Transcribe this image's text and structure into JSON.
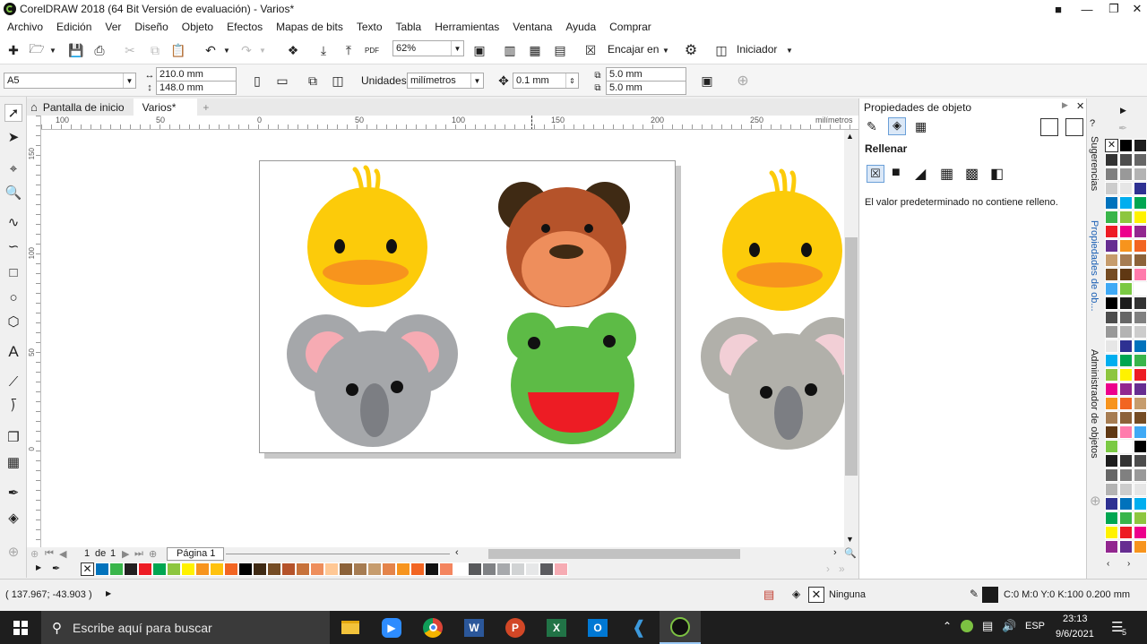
{
  "window": {
    "title": "CorelDRAW 2018 (64 Bit Versión de evaluación) - Varios*"
  },
  "menu": [
    "Archivo",
    "Edición",
    "Ver",
    "Diseño",
    "Objeto",
    "Efectos",
    "Mapas de bits",
    "Texto",
    "Tabla",
    "Herramientas",
    "Ventana",
    "Ayuda",
    "Comprar"
  ],
  "toolbar": {
    "zoom": "62%",
    "fit_label": "Encajar en",
    "launcher_label": "Iniciador"
  },
  "propbar": {
    "page_size": "A5",
    "width": "210.0 mm",
    "height": "148.0 mm",
    "units_label": "Unidades:",
    "units": "milímetros",
    "nudge": "0.1 mm",
    "dup_x": "5.0 mm",
    "dup_y": "5.0 mm"
  },
  "tabs": {
    "home": "Pantalla de inicio",
    "doc": "Varios*"
  },
  "ruler": {
    "h_ticks": [
      "100",
      "50",
      "0",
      "50",
      "100",
      "150",
      "200",
      "250"
    ],
    "unit": "milímetros",
    "v_ticks": [
      "150",
      "100",
      "50",
      "0"
    ]
  },
  "pagenav": {
    "current": "1",
    "of": "de",
    "total": "1",
    "page_tab": "Página 1"
  },
  "panel": {
    "title": "Propiedades de objeto",
    "section": "Rellenar",
    "message": "El valor predeterminado no contiene relleno."
  },
  "sidetabs": [
    "Sugerencias",
    "Propiedades de ob...",
    "Administrador de objetos"
  ],
  "status": {
    "coords": "( 137.967; -43.903 )",
    "fill_text": "Ninguna",
    "outline_text": "C:0 M:0 Y:0 K:100  0.200 mm"
  },
  "taskbar": {
    "search_placeholder": "Escribe aquí para buscar",
    "lang": "ESP",
    "time": "23:13",
    "date": "9/6/2021",
    "notif_count": "5"
  },
  "colors": {
    "duck": "#fccb0a",
    "beak": "#f7941d",
    "bear": "#b5532a",
    "bear_ear": "#3f2a14",
    "bear_muzzle": "#ee8e5c",
    "koala": "#a5a7aa",
    "koala_ear": "#f6abb3",
    "koala_nose": "#7c7e83",
    "frog": "#5dbb46",
    "mouth": "#ed1c24",
    "canvas": "#ffffff"
  },
  "doc_palette": [
    "#0072bc",
    "#39b54a",
    "#231f20",
    "#ed1c24",
    "#00a651",
    "#8dc63f",
    "#fff200",
    "#f7941d",
    "#ffc20e",
    "#f26522",
    "#000000",
    "#3f2a14",
    "#754c24",
    "#b5532a",
    "#c7723a",
    "#ee8e5c",
    "#ffc895",
    "#8c6239",
    "#a67c52",
    "#c69c6d",
    "#e4844a",
    "#f7941d",
    "#f26522",
    "#111111",
    "#f4855e",
    "#ffffff",
    "#58595b",
    "#808285",
    "#a7a9ac",
    "#d1d3d4",
    "#e6e7e8",
    "#5b5b5f",
    "#f6abb3"
  ],
  "color_palette": [
    "#ffffff",
    "#000000",
    "#1d1d1d",
    "#333333",
    "#4d4d4d",
    "#666666",
    "#808080",
    "#999999",
    "#b3b3b3",
    "#cccccc",
    "#e6e6e6",
    "#2e3192",
    "#0072bc",
    "#00aeef",
    "#00a651",
    "#39b54a",
    "#8dc63f",
    "#fff200",
    "#ed1c24",
    "#ec008c",
    "#92278f",
    "#662d91",
    "#f7941d",
    "#f26522",
    "#c69c6d",
    "#a67c52",
    "#8c6239",
    "#754c24",
    "#603813",
    "#ff7bac",
    "#3fa9f5",
    "#7ac943"
  ]
}
